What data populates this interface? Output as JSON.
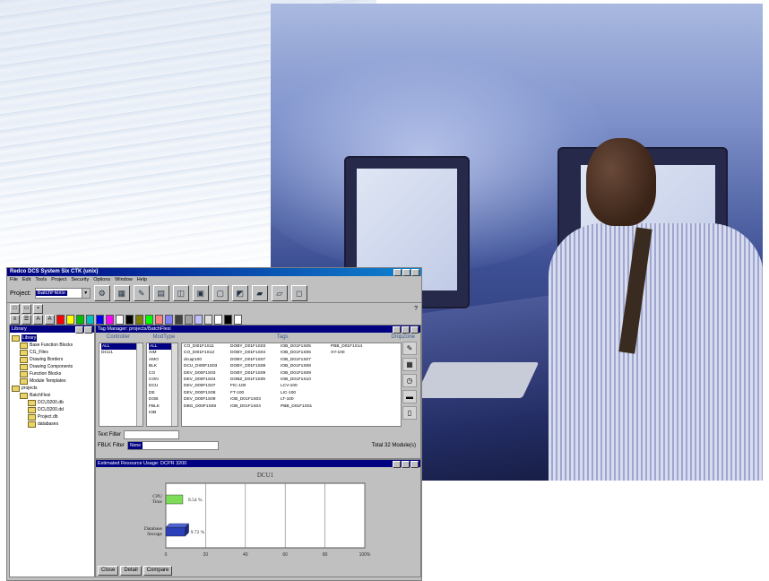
{
  "window": {
    "title": "Redco DCS System Six CTK (unix)"
  },
  "menu": [
    "File",
    "Edit",
    "Tools",
    "Project",
    "Security",
    "Options",
    "Window",
    "Help"
  ],
  "toolbar": {
    "project_label": "Project:",
    "project_value": "BatchFlexsi",
    "help": "?"
  },
  "library": {
    "title": "Library",
    "items": [
      {
        "label": "Library",
        "level": 0,
        "selected": true
      },
      {
        "label": "Base Function Blocks",
        "level": 1
      },
      {
        "label": "CG_Files",
        "level": 1
      },
      {
        "label": "Drawing Borders",
        "level": 1
      },
      {
        "label": "Drawing Components",
        "level": 1
      },
      {
        "label": "Function Blocks",
        "level": 1
      },
      {
        "label": "Module Templates",
        "level": 1
      },
      {
        "label": "projects",
        "level": 0
      },
      {
        "label": "BatchFlexi",
        "level": 1
      },
      {
        "label": "DCU3200.db",
        "level": 2
      },
      {
        "label": "DCU3200.dd",
        "level": 2
      },
      {
        "label": "Project.db",
        "level": 2
      },
      {
        "label": "databases",
        "level": 2
      }
    ]
  },
  "tag_manager": {
    "title": "Tag Manager: projects/BatchFlexi",
    "col_controller": "Controller",
    "col_modtype": "ModType",
    "col_tags": "Tags",
    "col_dropzone": "DropZone",
    "controllers": [
      "ALL",
      "DCU1"
    ],
    "modtypes": [
      "ALL",
      "AIM",
      "AMO",
      "BLK",
      "CO",
      "CON",
      "DCU",
      "DE",
      "DOB",
      "FBLK",
      "IOB"
    ],
    "tags": [
      [
        "CO_DI01F1S11",
        "DOBY_D01F1S03",
        "IOB_D01F1S05",
        "PBB_D01F1S14"
      ],
      [
        "CO_DI01F1S12",
        "DOBY_D01F1S04",
        "IOB_D01F1S06",
        "XY-100"
      ],
      [
        "dcuqr100",
        "DOBY_D01F1S07",
        "IOB_D01F1S07",
        ""
      ],
      [
        "DCU_DI00F1S03",
        "DOBY_D01F1S08",
        "IOB_D01F1S08",
        ""
      ],
      [
        "DEV_D00F1S03",
        "DOBY_D01F1S09",
        "IOB_D01F1S09",
        ""
      ],
      [
        "DEV_D00F1S04",
        "DOBZ_D01F1S09",
        "IOB_D01F1S10",
        ""
      ],
      [
        "DEV_D00F1S07",
        "FIC-100",
        "LCV-100",
        ""
      ],
      [
        "DEV_D00F1S08",
        "FT-100",
        "LIC-100",
        ""
      ],
      [
        "DEV_D00F1S09",
        "IOB_D01F1S03",
        "LT-100",
        ""
      ],
      [
        "DBG_D00F1S08",
        "IOB_D01F1S04",
        "PBB_D01F1S01",
        ""
      ]
    ],
    "text_filter_label": "Text Filter",
    "fblk_filter_label": "FBLK Filter",
    "fblk_filter_value": "None",
    "total": "Total 32 Module(s)"
  },
  "resource_usage": {
    "title": "Estimated Resource Usage: DCPR 3200",
    "buttons": [
      "Close",
      "Detail",
      "Compare"
    ]
  },
  "chart_data": {
    "type": "bar",
    "title": "DCU1",
    "categories": [
      "CPU Time",
      "Database Storage"
    ],
    "values": [
      8.54,
      9.72
    ],
    "value_labels": [
      "8.54 %",
      "9.72 %"
    ],
    "xlim": [
      0,
      100
    ],
    "xticks": [
      "0",
      "20",
      "40",
      "60",
      "80",
      "100%"
    ],
    "orientation": "horizontal",
    "bar_colors": [
      "#7ddc5a",
      "#2a3fb8"
    ],
    "grid": true
  }
}
